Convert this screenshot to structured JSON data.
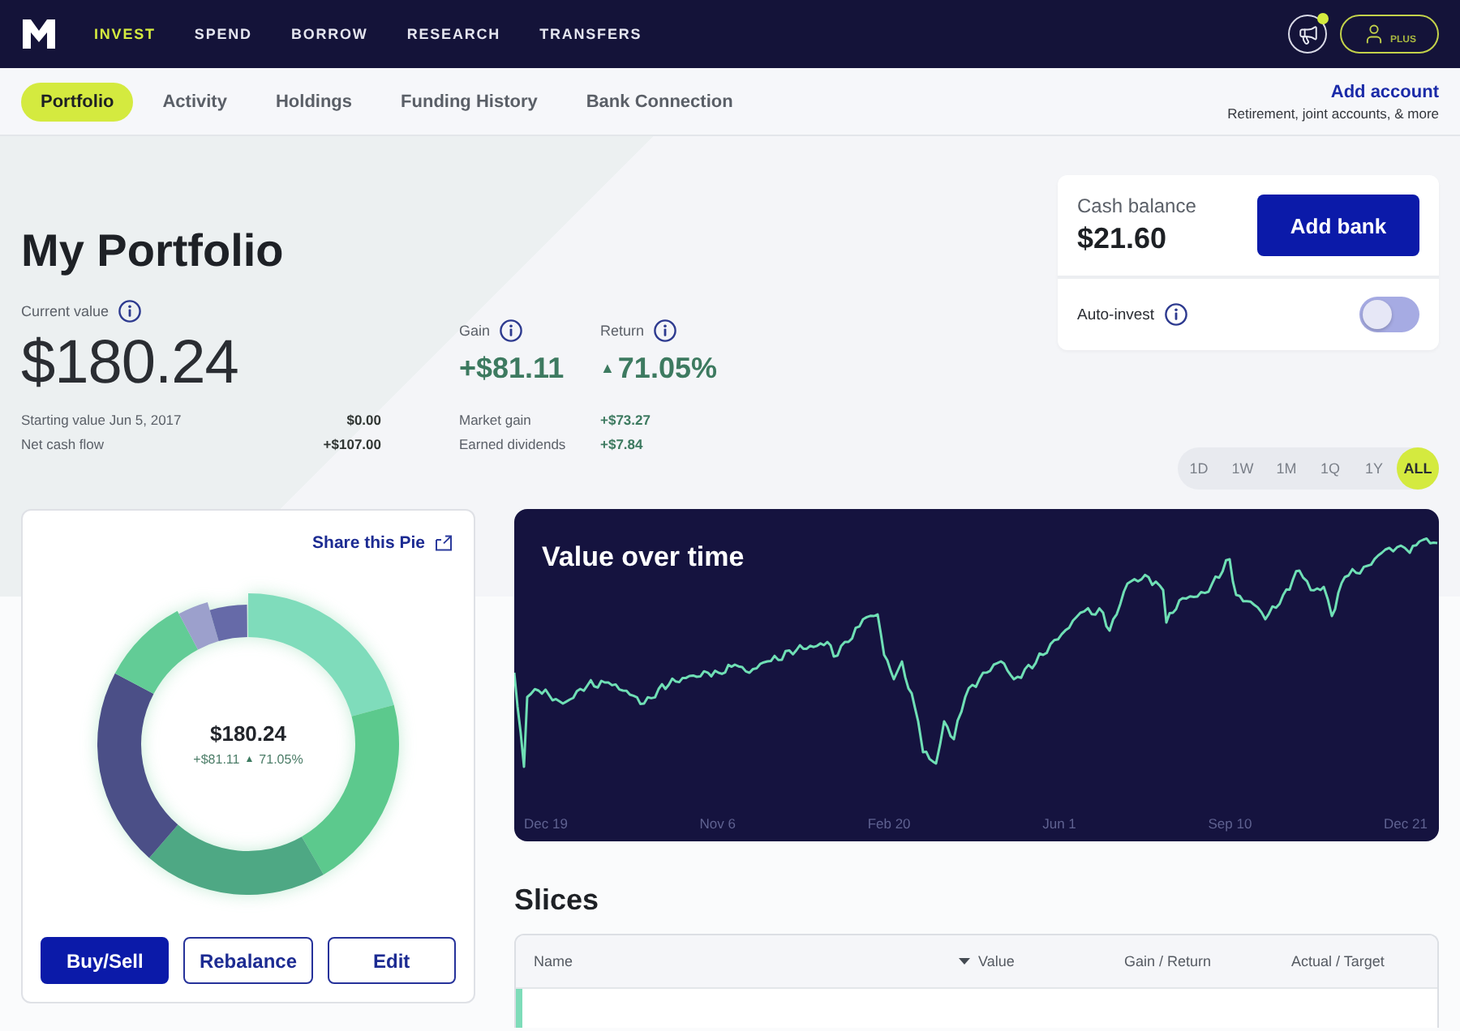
{
  "top_nav": {
    "items": [
      {
        "label": "INVEST",
        "selected": true
      },
      {
        "label": "SPEND",
        "selected": false
      },
      {
        "label": "BORROW",
        "selected": false
      },
      {
        "label": "RESEARCH",
        "selected": false
      },
      {
        "label": "TRANSFERS",
        "selected": false
      }
    ],
    "notification": true,
    "account_label": "PLUS"
  },
  "sub_nav": {
    "tabs": [
      {
        "label": "Portfolio",
        "selected": true
      },
      {
        "label": "Activity",
        "selected": false
      },
      {
        "label": "Holdings",
        "selected": false
      },
      {
        "label": "Funding History",
        "selected": false
      },
      {
        "label": "Bank Connection",
        "selected": false
      }
    ],
    "add_account": {
      "label": "Add account",
      "caption": "Retirement, joint accounts, & more"
    }
  },
  "portfolio": {
    "title": "My Portfolio",
    "current_value": {
      "label": "Current value",
      "value": "$180.24"
    },
    "details": [
      {
        "label": "Starting value Jun 5, 2017",
        "value": "$0.00"
      },
      {
        "label": "Net cash flow",
        "value": "+$107.00"
      }
    ],
    "gain": {
      "label": "Gain",
      "value": "+$81.11"
    },
    "return": {
      "label": "Return",
      "arrow": "▲",
      "value": "71.05%"
    },
    "gain_details": [
      {
        "label": "Market gain",
        "value": "+$73.27"
      },
      {
        "label": "Earned dividends",
        "value": "+$7.84"
      }
    ]
  },
  "cash_card": {
    "label": "Cash balance",
    "value": "$21.60",
    "button": "Add bank",
    "auto_invest": {
      "label": "Auto-invest",
      "on": false
    }
  },
  "ranges": [
    {
      "label": "1D",
      "selected": false
    },
    {
      "label": "1W",
      "selected": false
    },
    {
      "label": "1M",
      "selected": false
    },
    {
      "label": "1Q",
      "selected": false
    },
    {
      "label": "1Y",
      "selected": false
    },
    {
      "label": "ALL",
      "selected": true
    }
  ],
  "pie_card": {
    "share_link": "Share this Pie",
    "center_value": "$180.24",
    "center_gain": "+$81.11",
    "center_arrow": "▲",
    "center_return": "71.05%",
    "buttons": [
      {
        "label": "Buy/Sell",
        "kind": "primary"
      },
      {
        "label": "Rebalance",
        "kind": "outline"
      },
      {
        "label": "Edit",
        "kind": "outline"
      }
    ]
  },
  "value_chart": {
    "title": "Value over time",
    "x_labels": [
      "Dec 19",
      "Nov 6",
      "Feb 20",
      "Jun 1",
      "Sep 10",
      "Dec 21"
    ]
  },
  "slices": {
    "title": "Slices",
    "columns": [
      {
        "label": "Name",
        "sorted": false
      },
      {
        "label": "Value",
        "sorted": true
      },
      {
        "label": "Gain / Return",
        "sorted": false
      },
      {
        "label": "Actual / Target",
        "sorted": false
      }
    ],
    "rows": [
      {
        "color": "#7edcb9"
      }
    ]
  }
}
